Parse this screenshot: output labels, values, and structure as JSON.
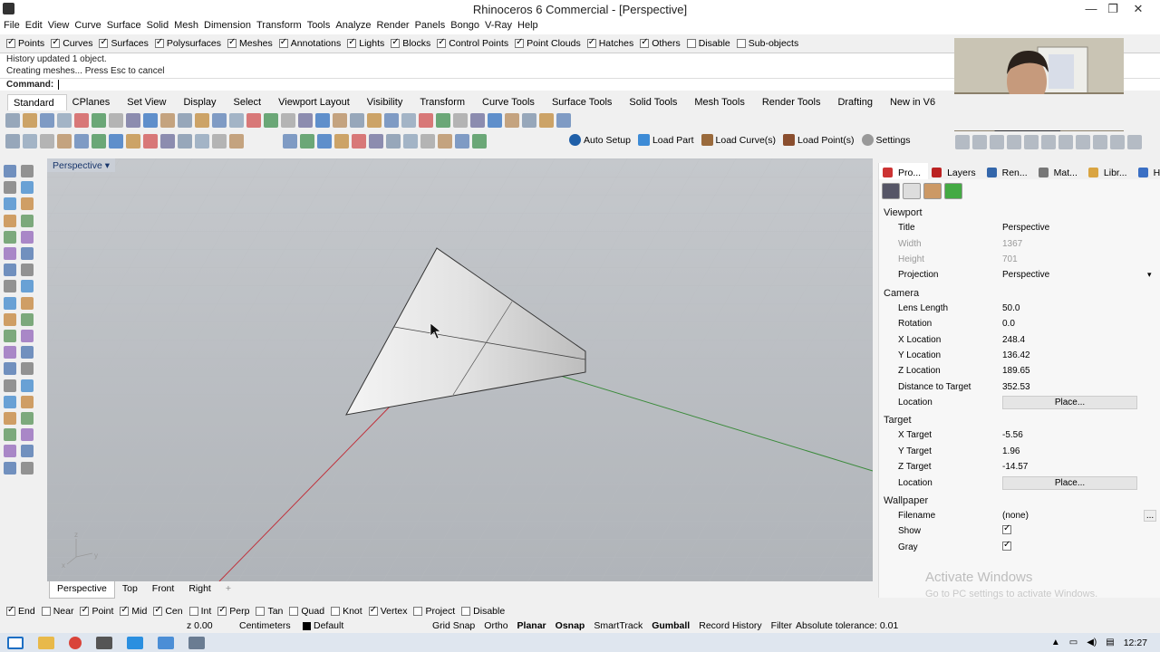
{
  "window": {
    "title": "Rhinoceros 6 Commercial - [Perspective]",
    "minimize": "—",
    "maximize": "❐",
    "close": "✕"
  },
  "menu": [
    "File",
    "Edit",
    "View",
    "Curve",
    "Surface",
    "Solid",
    "Mesh",
    "Dimension",
    "Transform",
    "Tools",
    "Analyze",
    "Render",
    "Panels",
    "Bongo",
    "V-Ray",
    "Help"
  ],
  "filters": [
    {
      "label": "Points",
      "on": true
    },
    {
      "label": "Curves",
      "on": true
    },
    {
      "label": "Surfaces",
      "on": true
    },
    {
      "label": "Polysurfaces",
      "on": true
    },
    {
      "label": "Meshes",
      "on": true
    },
    {
      "label": "Annotations",
      "on": true
    },
    {
      "label": "Lights",
      "on": true
    },
    {
      "label": "Blocks",
      "on": true
    },
    {
      "label": "Control Points",
      "on": true
    },
    {
      "label": "Point Clouds",
      "on": true
    },
    {
      "label": "Hatches",
      "on": true
    },
    {
      "label": "Others",
      "on": true
    },
    {
      "label": "Disable",
      "on": false
    },
    {
      "label": "Sub-objects",
      "on": false
    }
  ],
  "history": {
    "line1": "History updated 1 object.",
    "line2": "Creating meshes... Press Esc to cancel",
    "command_label": "Command:"
  },
  "tabs": [
    "Standard",
    "CPlanes",
    "Set View",
    "Display",
    "Select",
    "Viewport Layout",
    "Visibility",
    "Transform",
    "Curve Tools",
    "Surface Tools",
    "Solid Tools",
    "Mesh Tools",
    "Render Tools",
    "Drafting",
    "New in V6"
  ],
  "toolbar2": {
    "auto_setup": "Auto Setup",
    "load_part": "Load Part",
    "load_curves": "Load Curve(s)",
    "load_points": "Load Point(s)",
    "settings": "Settings"
  },
  "viewport": {
    "label": "Perspective",
    "tabs": [
      "Perspective",
      "Top",
      "Front",
      "Right"
    ],
    "add": "+"
  },
  "panel": {
    "tabs": [
      "Pro...",
      "Layers",
      "Ren...",
      "Mat...",
      "Libr...",
      "Help"
    ],
    "viewport_section": "Viewport",
    "title_k": "Title",
    "title_v": "Perspective",
    "width_k": "Width",
    "width_v": "1367",
    "height_k": "Height",
    "height_v": "701",
    "projection_k": "Projection",
    "projection_v": "Perspective",
    "camera_section": "Camera",
    "lens_k": "Lens Length",
    "lens_v": "50.0",
    "rotation_k": "Rotation",
    "rotation_v": "0.0",
    "xloc_k": "X Location",
    "xloc_v": "248.4",
    "yloc_k": "Y Location",
    "yloc_v": "136.42",
    "zloc_k": "Z Location",
    "zloc_v": "189.65",
    "dist_k": "Distance to Target",
    "dist_v": "352.53",
    "loc_k": "Location",
    "place": "Place...",
    "target_section": "Target",
    "xt_k": "X Target",
    "xt_v": "-5.56",
    "yt_k": "Y Target",
    "yt_v": "1.96",
    "zt_k": "Z Target",
    "zt_v": "-14.57",
    "wallpaper_section": "Wallpaper",
    "file_k": "Filename",
    "file_v": "(none)",
    "file_btn": "...",
    "show_k": "Show",
    "gray_k": "Gray"
  },
  "activate": {
    "line1": "Activate Windows",
    "line2": "Go to PC settings to activate Windows."
  },
  "osnaps": [
    {
      "label": "End",
      "on": true
    },
    {
      "label": "Near",
      "on": false
    },
    {
      "label": "Point",
      "on": true
    },
    {
      "label": "Mid",
      "on": true
    },
    {
      "label": "Cen",
      "on": true
    },
    {
      "label": "Int",
      "on": false
    },
    {
      "label": "Perp",
      "on": true
    },
    {
      "label": "Tan",
      "on": false
    },
    {
      "label": "Quad",
      "on": false
    },
    {
      "label": "Knot",
      "on": false
    },
    {
      "label": "Vertex",
      "on": true
    },
    {
      "label": "Project",
      "on": false
    },
    {
      "label": "Disable",
      "on": false
    }
  ],
  "status": {
    "z": "z 0.00",
    "units": "Centimeters",
    "layer": "Default",
    "grid_snap": "Grid Snap",
    "ortho": "Ortho",
    "planar": "Planar",
    "osnap": "Osnap",
    "smarttrack": "SmartTrack",
    "gumball": "Gumball",
    "record_history": "Record History",
    "filter": "Filter",
    "tolerance": "Absolute tolerance: 0.01"
  },
  "clock": "12:27",
  "axis": {
    "x": "x",
    "y": "y",
    "z": "z"
  }
}
